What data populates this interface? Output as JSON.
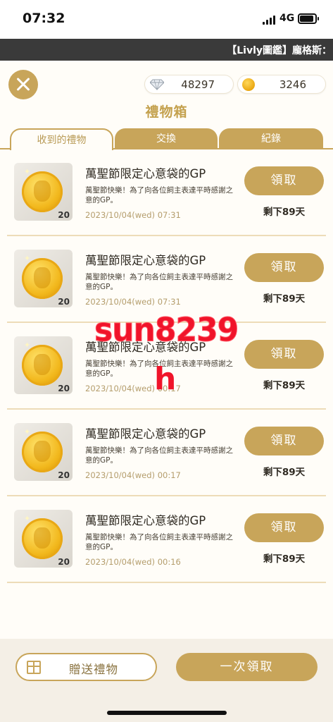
{
  "status_bar": {
    "time": "07:32",
    "network": "4G"
  },
  "ticker": {
    "text": "【Livly圖鑑】龐格斯："
  },
  "header": {
    "title": "禮物箱",
    "diamonds": "48297",
    "coins": "3246"
  },
  "tabs": [
    {
      "label": "收到的禮物",
      "active": true
    },
    {
      "label": "交換",
      "active": false
    },
    {
      "label": "紀錄",
      "active": false
    }
  ],
  "gifts": [
    {
      "name": "萬聖節限定心意袋的GP",
      "description": "萬聖節快樂！為了向各位飼主表達平時感謝之意的GP。",
      "date": "2023/10/04(wed) 07:31",
      "quantity": "20",
      "claim_label": "領取",
      "remaining": "剩下89天"
    },
    {
      "name": "萬聖節限定心意袋的GP",
      "description": "萬聖節快樂！為了向各位飼主表達平時感謝之意的GP。",
      "date": "2023/10/04(wed) 07:31",
      "quantity": "20",
      "claim_label": "領取",
      "remaining": "剩下89天"
    },
    {
      "name": "萬聖節限定心意袋的GP",
      "description": "萬聖節快樂！為了向各位飼主表達平時感謝之意的GP。",
      "date": "2023/10/04(wed) 00:17",
      "quantity": "20",
      "claim_label": "領取",
      "remaining": "剩下89天"
    },
    {
      "name": "萬聖節限定心意袋的GP",
      "description": "萬聖節快樂！為了向各位飼主表達平時感謝之意的GP。",
      "date": "2023/10/04(wed) 00:17",
      "quantity": "20",
      "claim_label": "領取",
      "remaining": "剩下89天"
    },
    {
      "name": "萬聖節限定心意袋的GP",
      "description": "萬聖節快樂！為了向各位飼主表達平時感謝之意的GP。",
      "date": "2023/10/04(wed) 00:16",
      "quantity": "20",
      "claim_label": "領取",
      "remaining": "剩下89天"
    }
  ],
  "watermark": {
    "line1": "sun8239",
    "line2": "h"
  },
  "footer": {
    "send_label": "贈送禮物",
    "claim_all_label": "一次領取"
  },
  "colors": {
    "gold": "#c8a55a",
    "title_gold": "#c4a14e",
    "watermark_red": "#f0142a",
    "ticker_bg": "#3a3a3a"
  }
}
